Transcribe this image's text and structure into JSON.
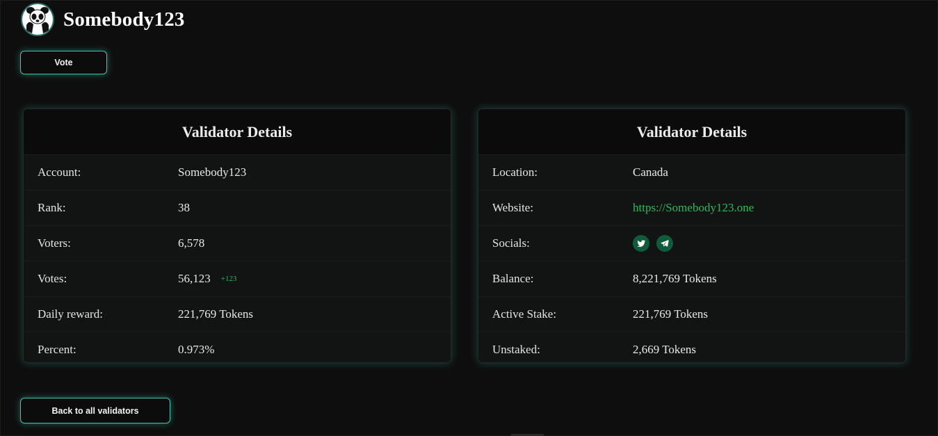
{
  "header": {
    "name": "Somebody123",
    "avatar_icon": "panda-logo-icon"
  },
  "actions": {
    "vote_label": "Vote",
    "back_label": "Back to all validators"
  },
  "left_card": {
    "title": "Validator Details",
    "rows": [
      {
        "label": "Account:",
        "value": "Somebody123"
      },
      {
        "label": "Rank:",
        "value": "38"
      },
      {
        "label": "Voters:",
        "value": "6,578"
      },
      {
        "label": "Votes:",
        "value": "56,123",
        "delta": "+123"
      },
      {
        "label": "Daily reward:",
        "value": "221,769 Tokens"
      },
      {
        "label": "Percent:",
        "value": "0.973%"
      }
    ]
  },
  "right_card": {
    "title": "Validator Details",
    "rows": [
      {
        "label": "Location:",
        "value": "Canada"
      },
      {
        "label": "Website:",
        "value": "https://Somebody123.one"
      },
      {
        "label": "Socials:",
        "icons": [
          "twitter-icon",
          "telegram-icon"
        ]
      },
      {
        "label": "Balance:",
        "value": "8,221,769 Tokens"
      },
      {
        "label": "Active Stake:",
        "value": "221,769 Tokens"
      },
      {
        "label": "Unstaked:",
        "value": "2,669 Tokens"
      }
    ]
  },
  "colors": {
    "accent": "#3fc7ae",
    "link": "#2fb75e",
    "background": "#0e0e0e",
    "card": "#121414"
  }
}
